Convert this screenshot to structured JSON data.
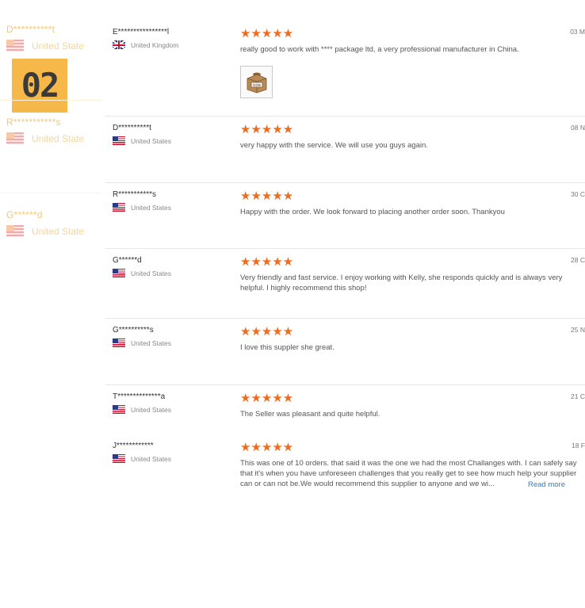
{
  "ghost": {
    "entries": [
      {
        "name": "D**********t",
        "country": "United State"
      },
      {
        "name": "R***********s",
        "country": "United State"
      },
      {
        "name": "G******d",
        "country": "United State"
      }
    ],
    "badge": "02"
  },
  "stars_icon_text": "★★★★★",
  "reviews": [
    {
      "name": "E****************l",
      "country": "United Kingdom",
      "flag": "uk-flag-icon",
      "date": "03 M",
      "rating": 5,
      "text": "really good to work with **** package ltd, a very professional manufacturer in China.",
      "has_image": true,
      "image_label": "COS"
    },
    {
      "name": "D**********t",
      "country": "United States",
      "flag": "us-flag-icon",
      "date": "08 N",
      "rating": 5,
      "text": "very happy with the service. We will use you guys again."
    },
    {
      "name": "R***********s",
      "country": "United States",
      "flag": "us-flag-icon",
      "date": "30 C",
      "rating": 5,
      "text": "Happy with the order. We look forward to placing another order soon. Thankyou"
    },
    {
      "name": "G******d",
      "country": "United States",
      "flag": "us-flag-icon",
      "date": "28 C",
      "rating": 5,
      "text": "Very friendly and fast service. I enjoy working with Kelly, she responds quickly and is always very helpful. I highly recommend this shop!"
    },
    {
      "name": "G**********s",
      "country": "United States",
      "flag": "us-flag-icon",
      "date": "25 N",
      "rating": 5,
      "text": "I love this suppler she great."
    },
    {
      "name": "T**************a",
      "country": "United States",
      "flag": "us-flag-icon",
      "date": "21 C",
      "rating": 5,
      "text": "The Seller was pleasant and quite helpful."
    },
    {
      "name": "J************",
      "country": "United States",
      "flag": "us-flag-icon",
      "date": "18 F",
      "rating": 5,
      "text": "This was one of 10 orders. that said it was the one we had the most Challanges with. I can safely say that it's when you have  unforeseen challenges that you really get to see how much help your supplier can or can not be.We would recommend this supplier to anyone and we wi...",
      "read_more": "Read more"
    }
  ]
}
